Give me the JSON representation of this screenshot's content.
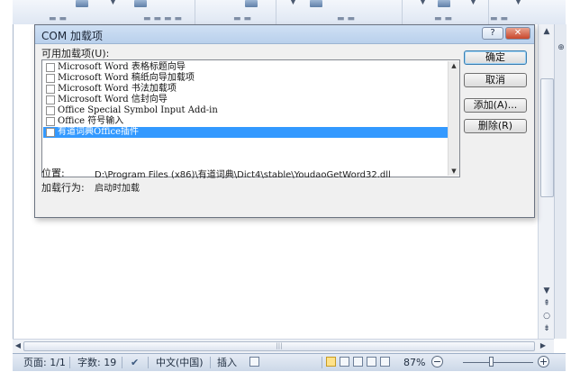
{
  "dialog": {
    "title": "COM 加载项",
    "help_label": "?",
    "close_label": "✕",
    "list_label": "可用加载项(U):",
    "addins": [
      {
        "label": "Microsoft Word 表格标题向导",
        "checked": false,
        "selected": false
      },
      {
        "label": "Microsoft Word 稿纸向导加载项",
        "checked": false,
        "selected": false
      },
      {
        "label": "Microsoft Word 书法加载项",
        "checked": false,
        "selected": false
      },
      {
        "label": "Microsoft Word 信封向导",
        "checked": false,
        "selected": false
      },
      {
        "label": "Office Special Symbol Input Add-in",
        "checked": false,
        "selected": false
      },
      {
        "label": "Office 符号输入",
        "checked": false,
        "selected": false
      },
      {
        "label": "有道词典Office插件",
        "checked": false,
        "selected": true
      }
    ],
    "buttons": {
      "ok": "确定",
      "cancel": "取消",
      "add": "添加(A)...",
      "remove": "删除(R)"
    },
    "location_label": "位置:",
    "location_value": "D:\\Program Files (x86)\\有道词典\\Dict4\\stable\\YoudaoGetWord32.dll",
    "load_behavior_label": "加载行为:",
    "load_behavior_value": "启动时加载"
  },
  "statusbar": {
    "page": "页面: 1/1",
    "word_count": "字数: 19",
    "language": "中文(中国)",
    "insert_mode": "插入",
    "zoom": "87%",
    "zoom_minus": "−",
    "zoom_plus": "+"
  },
  "colors": {
    "selection": "#3399ff",
    "close_button": "#c8462b",
    "titlebar": "#c3d7f0"
  }
}
